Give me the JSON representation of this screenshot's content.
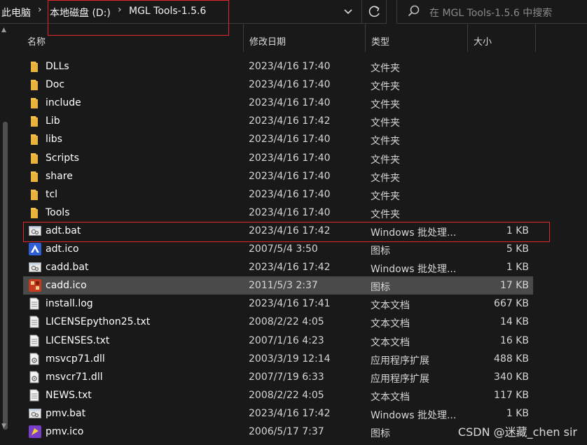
{
  "breadcrumb": [
    "此电脑",
    "本地磁盘 (D:)",
    "MGL Tools-1.5.6"
  ],
  "search": {
    "placeholder": "在 MGL Tools-1.5.6 中搜索"
  },
  "columns": {
    "name": "名称",
    "date": "修改日期",
    "type": "类型",
    "size": "大小"
  },
  "files": [
    {
      "name": "DLLs",
      "date": "2023/4/16 17:40",
      "type": "文件夹",
      "size": "",
      "icon": "folder-icon"
    },
    {
      "name": "Doc",
      "date": "2023/4/16 17:40",
      "type": "文件夹",
      "size": "",
      "icon": "folder-icon"
    },
    {
      "name": "include",
      "date": "2023/4/16 17:40",
      "type": "文件夹",
      "size": "",
      "icon": "folder-icon"
    },
    {
      "name": "Lib",
      "date": "2023/4/16 17:42",
      "type": "文件夹",
      "size": "",
      "icon": "folder-icon"
    },
    {
      "name": "libs",
      "date": "2023/4/16 17:40",
      "type": "文件夹",
      "size": "",
      "icon": "folder-icon"
    },
    {
      "name": "Scripts",
      "date": "2023/4/16 17:40",
      "type": "文件夹",
      "size": "",
      "icon": "folder-icon"
    },
    {
      "name": "share",
      "date": "2023/4/16 17:40",
      "type": "文件夹",
      "size": "",
      "icon": "folder-icon"
    },
    {
      "name": "tcl",
      "date": "2023/4/16 17:40",
      "type": "文件夹",
      "size": "",
      "icon": "folder-icon"
    },
    {
      "name": "Tools",
      "date": "2023/4/16 17:40",
      "type": "文件夹",
      "size": "",
      "icon": "folder-icon"
    },
    {
      "name": "adt.bat",
      "date": "2023/4/16 17:42",
      "type": "Windows 批处理...",
      "size": "1 KB",
      "icon": "batch-file-icon"
    },
    {
      "name": "adt.ico",
      "date": "2007/5/4 3:50",
      "type": "图标",
      "size": "5 KB",
      "icon": "blue-ico-icon"
    },
    {
      "name": "cadd.bat",
      "date": "2023/4/16 17:42",
      "type": "Windows 批处理...",
      "size": "1 KB",
      "icon": "batch-file-icon"
    },
    {
      "name": "cadd.ico",
      "date": "2011/5/3 2:37",
      "type": "图标",
      "size": "17 KB",
      "icon": "red-ico-icon"
    },
    {
      "name": "install.log",
      "date": "2023/4/16 17:41",
      "type": "文本文档",
      "size": "667 KB",
      "icon": "text-file-icon"
    },
    {
      "name": "LICENSEpython25.txt",
      "date": "2008/2/22 4:05",
      "type": "文本文档",
      "size": "14 KB",
      "icon": "text-file-icon"
    },
    {
      "name": "LICENSES.txt",
      "date": "2007/1/16 4:23",
      "type": "文本文档",
      "size": "16 KB",
      "icon": "text-file-icon"
    },
    {
      "name": "msvcp71.dll",
      "date": "2003/3/19 12:14",
      "type": "应用程序扩展",
      "size": "488 KB",
      "icon": "dll-file-icon"
    },
    {
      "name": "msvcr71.dll",
      "date": "2007/7/19 6:33",
      "type": "应用程序扩展",
      "size": "340 KB",
      "icon": "dll-file-icon"
    },
    {
      "name": "NEWS.txt",
      "date": "2008/2/22 4:05",
      "type": "文本文档",
      "size": "117 KB",
      "icon": "text-file-icon"
    },
    {
      "name": "pmv.bat",
      "date": "2023/4/16 17:42",
      "type": "Windows 批处理...",
      "size": "1 KB",
      "icon": "batch-file-icon"
    },
    {
      "name": "pmv.ico",
      "date": "2006/5/17 7:37",
      "type": "图标",
      "size": "",
      "icon": "pmv-ico-icon"
    }
  ],
  "selected_row": "cadd.ico",
  "highlighted_row": "adt.bat",
  "watermark": "CSDN @迷藏_chen sir",
  "colors": {
    "background": "#191919",
    "selected": "#4a4a4a",
    "annotation_red": "#e0282a",
    "folder": "#f1c04a"
  }
}
